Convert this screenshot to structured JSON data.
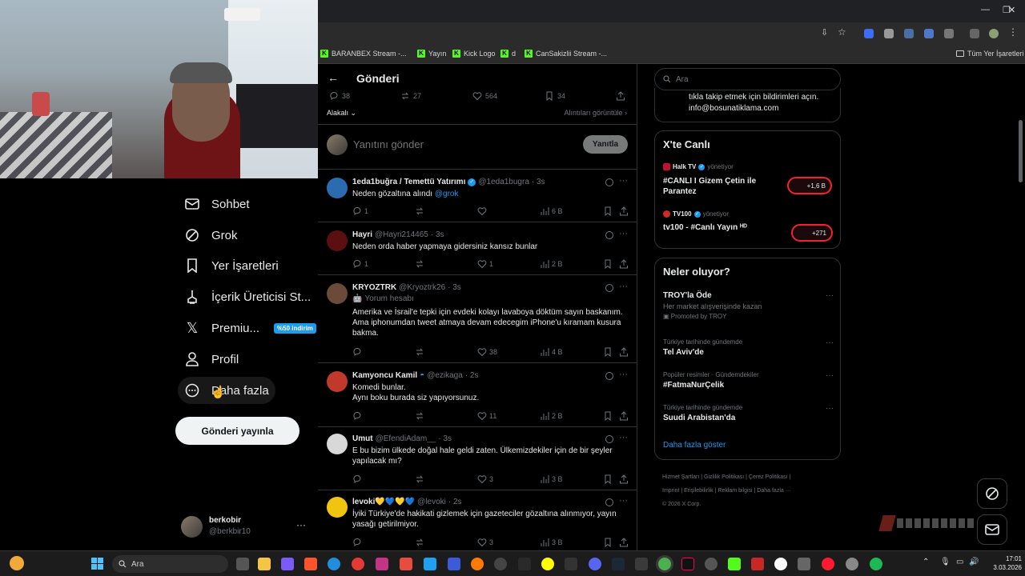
{
  "browser": {
    "bookmarks": [
      {
        "label": "BARANBEX Stream -..."
      },
      {
        "label": "Yayın"
      },
      {
        "label": "Kick Logo"
      },
      {
        "label": "d"
      },
      {
        "label": "CanSakizlii Stream -..."
      }
    ],
    "all_bookmarks": "Tüm Yer İşaretleri"
  },
  "nav": {
    "items": [
      {
        "label": "Sohbet"
      },
      {
        "label": "Grok"
      },
      {
        "label": "Yer İşaretleri"
      },
      {
        "label": "İçerik Üreticisi St..."
      },
      {
        "label": "Premiu..."
      },
      {
        "label": "Profil"
      },
      {
        "label": "Daha fazla"
      }
    ],
    "premium_badge": "%50 indirim",
    "post_button": "Gönderi yayınla",
    "account": {
      "name": "berkobir",
      "handle": "@berkbir10",
      "more": "···"
    }
  },
  "main": {
    "title": "Gönderi",
    "back": "←",
    "stats": {
      "replies": "38",
      "reposts": "27",
      "likes": "564",
      "bookmarks": "34"
    },
    "sort": "Alakalı",
    "quotes_link": "Alıntıları görüntüle",
    "reply_placeholder": "Yanıtını gönder",
    "reply_button": "Yanıtla",
    "replies": [
      {
        "name": "1eda1buğra / Temettü Yatırımı",
        "verified": true,
        "handle": "@1eda1bugra",
        "time": "· 3s",
        "text": "Neden gözaltına alındı ",
        "mention": "@grok",
        "replies": "1",
        "reposts": "",
        "likes": "",
        "views": "6 B",
        "avatar_color": "#2b6cb0"
      },
      {
        "name": "Hayri",
        "verified": false,
        "handle": "@Hayri214465",
        "time": "· 3s",
        "text": "Neden orda haber yapmaya gidersiniz kansız bunlar",
        "replies": "1",
        "reposts": "",
        "likes": "1",
        "views": "2 B",
        "avatar_color": "#5a1010"
      },
      {
        "name": "KRYOZTRK",
        "verified": false,
        "handle": "@Kryoztrk26",
        "time": "· 3s",
        "label": "Yorum hesabı",
        "text": "Amerika ve İsrail'e tepki için evdeki kolayı lavaboya döktüm sayın baskanım. Ama iphonumdan tweet atmaya devam edecegim iPhone'u kıramam kusura bakma.",
        "replies": "",
        "reposts": "",
        "likes": "38",
        "views": "4 B",
        "avatar_color": "#6b4a3a"
      },
      {
        "name": "Kamyoncu Kamil",
        "verified": false,
        "handle": "@ezikaga",
        "time": "· 2s",
        "text": "Komedi bunlar.\nAynı boku burada siz yapıyorsunuz.",
        "replies": "",
        "reposts": "",
        "likes": "11",
        "views": "2 B",
        "avatar_color": "#c0392b"
      },
      {
        "name": "Umut",
        "verified": false,
        "handle": "@EfendiAdam__",
        "time": "· 3s",
        "text": "E bu bizim ülkede doğal hale geldi zaten. Ülkemizdekiler için de bir şeyler yapılacak mı?",
        "replies": "",
        "reposts": "",
        "likes": "3",
        "views": "3 B",
        "avatar_color": "#d8d8d8"
      },
      {
        "name": "levoki💛💙💛💙",
        "verified": false,
        "handle": "@levoki",
        "time": "· 2s",
        "text": "İyiki Türkiye'de hakikati gizlemek için gazeteciler gözaltına alınmıyor, yayın yasağı getirilmiyor.",
        "replies": "",
        "reposts": "",
        "likes": "3",
        "views": "3 B",
        "avatar_color": "#f1c40f"
      }
    ]
  },
  "right": {
    "search_placeholder": "Ara",
    "promo_text_1": "tıkla takip etmek için bildirimleri açın.",
    "promo_text_2": "info@bosunatiklama.com",
    "live": {
      "title": "X'te Canlı",
      "items": [
        {
          "host": "Halk TV",
          "role": "yönetiyor",
          "title": "#CANLI I Gizem Çetin ile Parantez",
          "count": "+1,6 B"
        },
        {
          "host": "TV100",
          "role": "yönetiyor",
          "title": "tv100 - #Canlı Yayın ᴴᴰ",
          "count": "+271"
        }
      ]
    },
    "trends": {
      "title": "Neler oluyor?",
      "items": [
        {
          "title": "TROY'la Öde",
          "sub": "Her market alışverişinde kazan",
          "meta": "Promoted by TROY"
        },
        {
          "context": "Türkiye tarihinde gündemde",
          "title": "Tel Aviv'de"
        },
        {
          "context": "Popüler resimler · Gündemdekiler",
          "title": "#FatmaNurÇelik"
        },
        {
          "context": "Türkiye tarihinde gündemde",
          "title": "Suudi Arabistan'da"
        }
      ],
      "more": "Daha fazla göster"
    },
    "footer": [
      "Hizmet Şartları",
      "Gizlilik Politikası",
      "Çerez Politikası",
      "Imprint",
      "Erişilebilirlik",
      "Reklam bilgisi",
      "Daha fazla ···",
      "© 2026 X Corp."
    ]
  },
  "taskbar": {
    "search": "Ara",
    "time": "17:01",
    "date": "3.03.2026"
  },
  "icons": [
    "back-arrow-icon",
    "reply-icon",
    "repost-icon",
    "like-icon",
    "bookmark-icon",
    "share-icon",
    "views-icon",
    "grok-icon",
    "more-icon",
    "search-icon",
    "mail-icon",
    "windows-start-icon"
  ]
}
